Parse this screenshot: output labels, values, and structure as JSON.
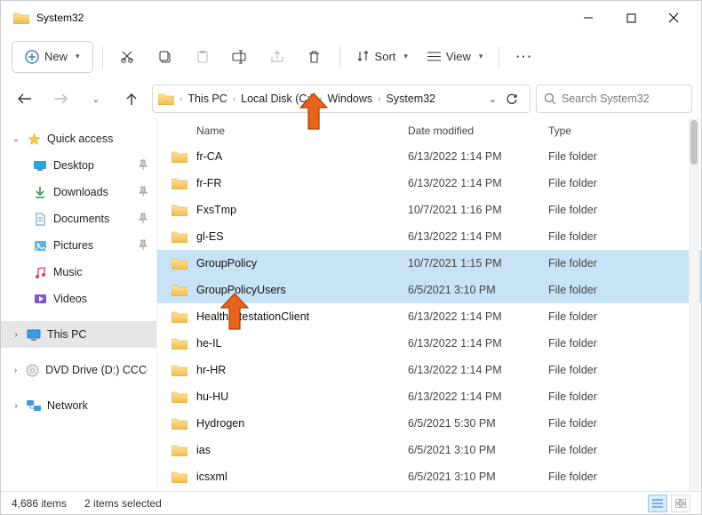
{
  "window": {
    "title": "System32"
  },
  "toolbar": {
    "new_label": "New",
    "sort_label": "Sort",
    "view_label": "View"
  },
  "breadcrumb": {
    "items": [
      "This PC",
      "Local Disk (C:)",
      "Windows",
      "System32"
    ]
  },
  "search": {
    "placeholder": "Search System32"
  },
  "sidebar": {
    "quick_access": "Quick access",
    "items": [
      {
        "label": "Desktop",
        "icon": "desktop",
        "pinned": true
      },
      {
        "label": "Downloads",
        "icon": "downloads",
        "pinned": true
      },
      {
        "label": "Documents",
        "icon": "documents",
        "pinned": true
      },
      {
        "label": "Pictures",
        "icon": "pictures",
        "pinned": true
      },
      {
        "label": "Music",
        "icon": "music",
        "pinned": false
      },
      {
        "label": "Videos",
        "icon": "videos",
        "pinned": false
      }
    ],
    "this_pc": "This PC",
    "dvd": "DVD Drive (D:) CCCC",
    "network": "Network"
  },
  "columns": {
    "name": "Name",
    "date": "Date modified",
    "type": "Type"
  },
  "files": [
    {
      "name": "fr-CA",
      "date": "6/13/2022 1:14 PM",
      "type": "File folder",
      "selected": false
    },
    {
      "name": "fr-FR",
      "date": "6/13/2022 1:14 PM",
      "type": "File folder",
      "selected": false
    },
    {
      "name": "FxsTmp",
      "date": "10/7/2021 1:16 PM",
      "type": "File folder",
      "selected": false
    },
    {
      "name": "gl-ES",
      "date": "6/13/2022 1:14 PM",
      "type": "File folder",
      "selected": false
    },
    {
      "name": "GroupPolicy",
      "date": "10/7/2021 1:15 PM",
      "type": "File folder",
      "selected": true
    },
    {
      "name": "GroupPolicyUsers",
      "date": "6/5/2021 3:10 PM",
      "type": "File folder",
      "selected": true
    },
    {
      "name": "HealthAttestationClient",
      "date": "6/13/2022 1:14 PM",
      "type": "File folder",
      "selected": false
    },
    {
      "name": "he-IL",
      "date": "6/13/2022 1:14 PM",
      "type": "File folder",
      "selected": false
    },
    {
      "name": "hr-HR",
      "date": "6/13/2022 1:14 PM",
      "type": "File folder",
      "selected": false
    },
    {
      "name": "hu-HU",
      "date": "6/13/2022 1:14 PM",
      "type": "File folder",
      "selected": false
    },
    {
      "name": "Hydrogen",
      "date": "6/5/2021 5:30 PM",
      "type": "File folder",
      "selected": false
    },
    {
      "name": "ias",
      "date": "6/5/2021 3:10 PM",
      "type": "File folder",
      "selected": false
    },
    {
      "name": "icsxml",
      "date": "6/5/2021 3:10 PM",
      "type": "File folder",
      "selected": false
    }
  ],
  "status": {
    "count": "4,686 items",
    "selected": "2 items selected"
  },
  "colors": {
    "folder": "#f8d570",
    "selection": "#c9e3f6"
  }
}
